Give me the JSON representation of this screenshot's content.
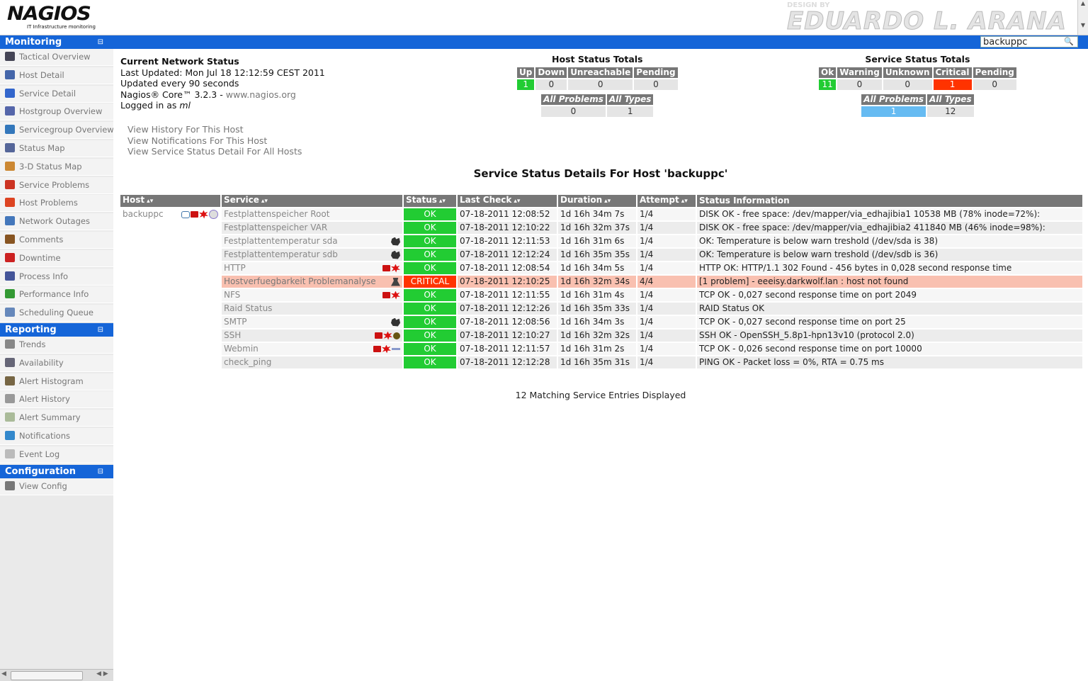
{
  "header": {
    "logo_text": "NAGIOS",
    "logo_subtitle": "IT Infrastructure monitoring",
    "designer_prefix": "DESIGN BY",
    "designer_name": "EDUARDO L. ARANA",
    "search_value": "backuppc"
  },
  "sidebar": {
    "monitoring": {
      "title": "Monitoring",
      "items": [
        {
          "label": "Tactical Overview",
          "icon": "monitor-icon",
          "color": "#445"
        },
        {
          "label": "Host Detail",
          "icon": "host-icon",
          "color": "#4466aa"
        },
        {
          "label": "Service Detail",
          "icon": "service-icon",
          "color": "#3366cc"
        },
        {
          "label": "Hostgroup Overview",
          "icon": "hostgroup-icon",
          "color": "#5566aa"
        },
        {
          "label": "Servicegroup Overview",
          "icon": "servicegroup-icon",
          "color": "#3377bb"
        },
        {
          "label": "Status Map",
          "icon": "status-map-icon",
          "color": "#556699"
        },
        {
          "label": "3-D Status Map",
          "icon": "3d-map-icon",
          "color": "#cc8833"
        },
        {
          "label": "Service Problems",
          "icon": "service-problems-icon",
          "color": "#cc3322"
        },
        {
          "label": "Host Problems",
          "icon": "host-problems-icon",
          "color": "#dd4422"
        },
        {
          "label": "Network Outages",
          "icon": "network-outages-icon",
          "color": "#4477bb"
        },
        {
          "label": "Comments",
          "icon": "comments-icon",
          "color": "#885522"
        },
        {
          "label": "Downtime",
          "icon": "downtime-icon",
          "color": "#cc2222"
        },
        {
          "label": "Process Info",
          "icon": "process-info-icon",
          "color": "#445599"
        },
        {
          "label": "Performance Info",
          "icon": "performance-info-icon",
          "color": "#339933"
        },
        {
          "label": "Scheduling Queue",
          "icon": "scheduling-queue-icon",
          "color": "#6688bb"
        }
      ]
    },
    "reporting": {
      "title": "Reporting",
      "items": [
        {
          "label": "Trends",
          "icon": "trends-icon",
          "color": "#888"
        },
        {
          "label": "Availability",
          "icon": "availability-icon",
          "color": "#667"
        },
        {
          "label": "Alert Histogram",
          "icon": "alert-histogram-icon",
          "color": "#776644"
        },
        {
          "label": "Alert History",
          "icon": "alert-history-icon",
          "color": "#999"
        },
        {
          "label": "Alert Summary",
          "icon": "alert-summary-icon",
          "color": "#aabb99"
        },
        {
          "label": "Notifications",
          "icon": "notifications-icon",
          "color": "#3388cc"
        },
        {
          "label": "Event Log",
          "icon": "event-log-icon",
          "color": "#bbb"
        }
      ]
    },
    "configuration": {
      "title": "Configuration",
      "items": [
        {
          "label": "View Config",
          "icon": "view-config-icon",
          "color": "#777"
        }
      ]
    },
    "collapse_glyph": "⊟"
  },
  "status": {
    "title": "Current Network Status",
    "last_updated": "Last Updated: Mon Jul 18 12:12:59 CEST 2011",
    "update_interval": "Updated every 90 seconds",
    "core_prefix": "Nagios® Core™ 3.2.3 - ",
    "core_link": "www.nagios.org",
    "logged_prefix": "Logged in as ",
    "logged_user": "ml"
  },
  "links": [
    "View History For This Host",
    "View Notifications For This Host",
    "View Service Status Detail For All Hosts"
  ],
  "host_totals": {
    "title": "Host Status Totals",
    "headers": [
      "Up",
      "Down",
      "Unreachable",
      "Pending"
    ],
    "values": [
      "1",
      "0",
      "0",
      "0"
    ],
    "sum_headers": [
      "All Problems",
      "All Types"
    ],
    "sum_values": [
      "0",
      "1"
    ]
  },
  "service_totals": {
    "title": "Service Status Totals",
    "headers": [
      "Ok",
      "Warning",
      "Unknown",
      "Critical",
      "Pending"
    ],
    "values": [
      "11",
      "0",
      "0",
      "1",
      "0"
    ],
    "sum_headers": [
      "All Problems",
      "All Types"
    ],
    "sum_values": [
      "1",
      "12"
    ]
  },
  "detail_title": "Service Status Details For Host 'backuppc'",
  "table": {
    "columns": [
      "Host",
      "Service",
      "Status",
      "Last Check",
      "Duration",
      "Attempt",
      "Status Information"
    ],
    "sort_glyph": "▴▾",
    "host": "backuppc",
    "rows": [
      {
        "service": "Festplattenspeicher Root",
        "status": "OK",
        "last_check": "07-18-2011 12:08:52",
        "duration": "1d 16h 34m 7s",
        "attempt": "1/4",
        "info": "DISK OK - free space: /dev/mapper/via_edhajibia1 10538 MB (78% inode=72%):",
        "icons": []
      },
      {
        "service": "Festplattenspeicher VAR",
        "status": "OK",
        "last_check": "07-18-2011 12:10:22",
        "duration": "1d 16h 32m 37s",
        "attempt": "1/4",
        "info": "DISK OK - free space: /dev/mapper/via_edhajibia2 411840 MB (46% inode=98%):",
        "icons": []
      },
      {
        "service": "Festplattentemperatur sda",
        "status": "OK",
        "last_check": "07-18-2011 12:11:53",
        "duration": "1d 16h 31m 6s",
        "attempt": "1/4",
        "info": "OK: Temperature is below warn treshold (/dev/sda is 38)",
        "icons": [
          "beast"
        ]
      },
      {
        "service": "Festplattentemperatur sdb",
        "status": "OK",
        "last_check": "07-18-2011 12:12:24",
        "duration": "1d 16h 35m 35s",
        "attempt": "1/4",
        "info": "OK: Temperature is below warn treshold (/dev/sdb is 36)",
        "icons": [
          "beast"
        ]
      },
      {
        "service": "HTTP",
        "status": "OK",
        "last_check": "07-18-2011 12:08:54",
        "duration": "1d 16h 34m 5s",
        "attempt": "1/4",
        "info": "HTTP OK: HTTP/1.1 302 Found - 456 bytes in 0,028 second response time",
        "icons": [
          "folder",
          "burst"
        ]
      },
      {
        "service": "Hostverfuegbarkeit Problemanalyse",
        "status": "CRITICAL",
        "last_check": "07-18-2011 12:10:25",
        "duration": "1d 16h 32m 34s",
        "attempt": "4/4",
        "info": "[1 problem] - eeeisy.darkwolf.lan : host not found",
        "icons": [
          "lab"
        ]
      },
      {
        "service": "NFS",
        "status": "OK",
        "last_check": "07-18-2011 12:11:55",
        "duration": "1d 16h 31m 4s",
        "attempt": "1/4",
        "info": "TCP OK - 0,027 second response time on port 2049",
        "icons": [
          "folder",
          "burst"
        ]
      },
      {
        "service": "Raid Status",
        "status": "OK",
        "last_check": "07-18-2011 12:12:26",
        "duration": "1d 16h 35m 33s",
        "attempt": "1/4",
        "info": "RAID Status OK",
        "icons": []
      },
      {
        "service": "SMTP",
        "status": "OK",
        "last_check": "07-18-2011 12:08:56",
        "duration": "1d 16h 34m 3s",
        "attempt": "1/4",
        "info": "TCP OK - 0,027 second response time on port 25",
        "icons": [
          "beast"
        ]
      },
      {
        "service": "SSH",
        "status": "OK",
        "last_check": "07-18-2011 12:10:27",
        "duration": "1d 16h 32m 32s",
        "attempt": "1/4",
        "info": "SSH OK - OpenSSH_5.8p1-hpn13v10 (protocol 2.0)",
        "icons": [
          "folder",
          "burst",
          "bug"
        ]
      },
      {
        "service": "Webmin",
        "status": "OK",
        "last_check": "07-18-2011 12:11:57",
        "duration": "1d 16h 31m 2s",
        "attempt": "1/4",
        "info": "TCP OK - 0,026 second response time on port 10000",
        "icons": [
          "folder",
          "burst",
          "arrow"
        ]
      },
      {
        "service": "check_ping",
        "status": "OK",
        "last_check": "07-18-2011 12:12:28",
        "duration": "1d 16h 35m 31s",
        "attempt": "1/4",
        "info": "PING OK - Packet loss = 0%, RTA = 0.75 ms",
        "icons": []
      }
    ]
  },
  "footer_count": "12 Matching Service Entries Displayed",
  "colors": {
    "accent": "#1565d8",
    "ok": "#22cc33",
    "critical": "#ff3300",
    "critical_row": "#f9c0b0",
    "problems_hl": "#66bbf2"
  }
}
